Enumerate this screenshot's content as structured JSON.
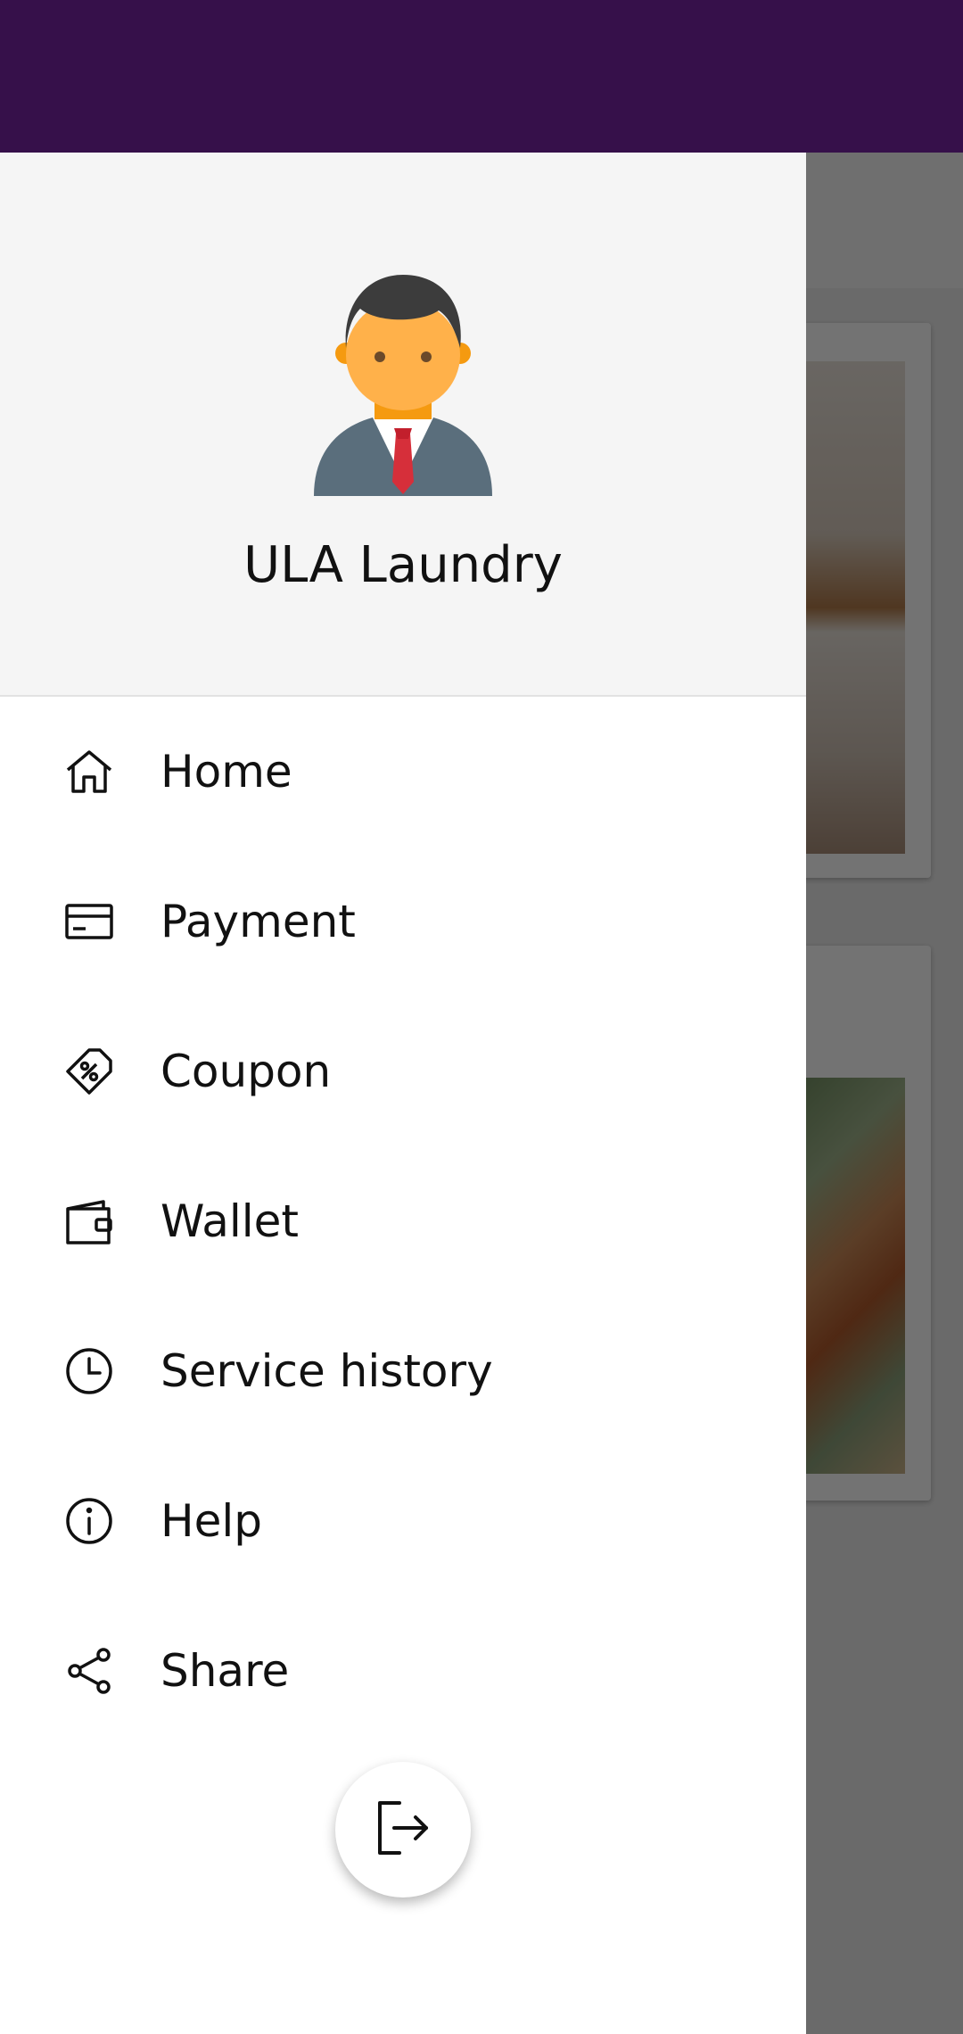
{
  "colors": {
    "topbar": "#36104a",
    "drawer_bg": "#ffffff",
    "header_bg": "#f5f5f5",
    "scrim": "rgba(0,0,0,0.55)"
  },
  "drawer": {
    "username": "ULA Laundry",
    "avatar_icon": "user-avatar-icon",
    "menu": [
      {
        "label": "Home",
        "icon": "home-icon"
      },
      {
        "label": "Payment",
        "icon": "credit-card-icon"
      },
      {
        "label": "Coupon",
        "icon": "coupon-icon"
      },
      {
        "label": "Wallet",
        "icon": "wallet-icon"
      },
      {
        "label": "Service history",
        "icon": "clock-icon"
      },
      {
        "label": "Help",
        "icon": "info-icon"
      },
      {
        "label": "Share",
        "icon": "share-icon"
      }
    ],
    "logout_icon": "logout-icon"
  }
}
